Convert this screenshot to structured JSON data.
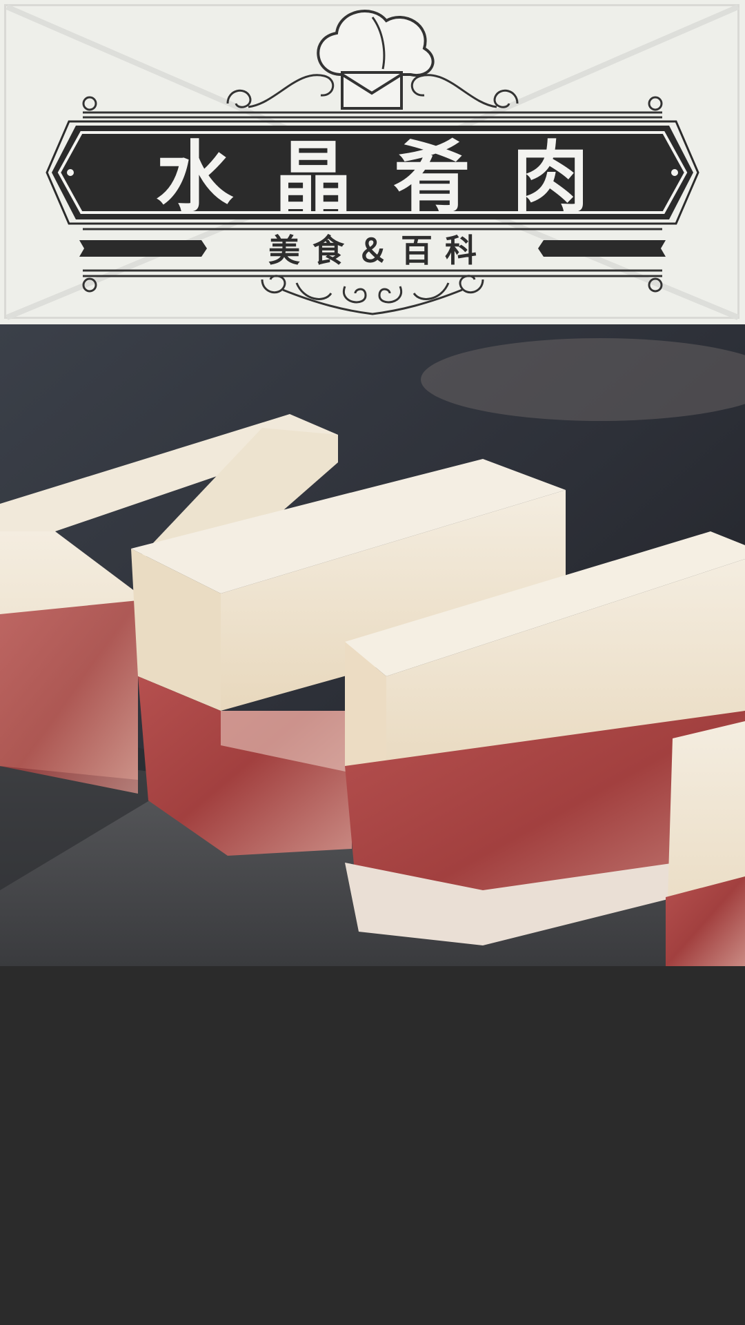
{
  "header": {
    "title": "水晶肴肉",
    "subtitle": "美食＆百科"
  },
  "icons": {
    "chef_hat": "chef-hat-icon",
    "ornament": "scroll-ornament-icon"
  },
  "colors": {
    "banner_dark": "#2b2b2b",
    "header_bg": "#eeefea",
    "title_text": "#f3f3f0"
  }
}
